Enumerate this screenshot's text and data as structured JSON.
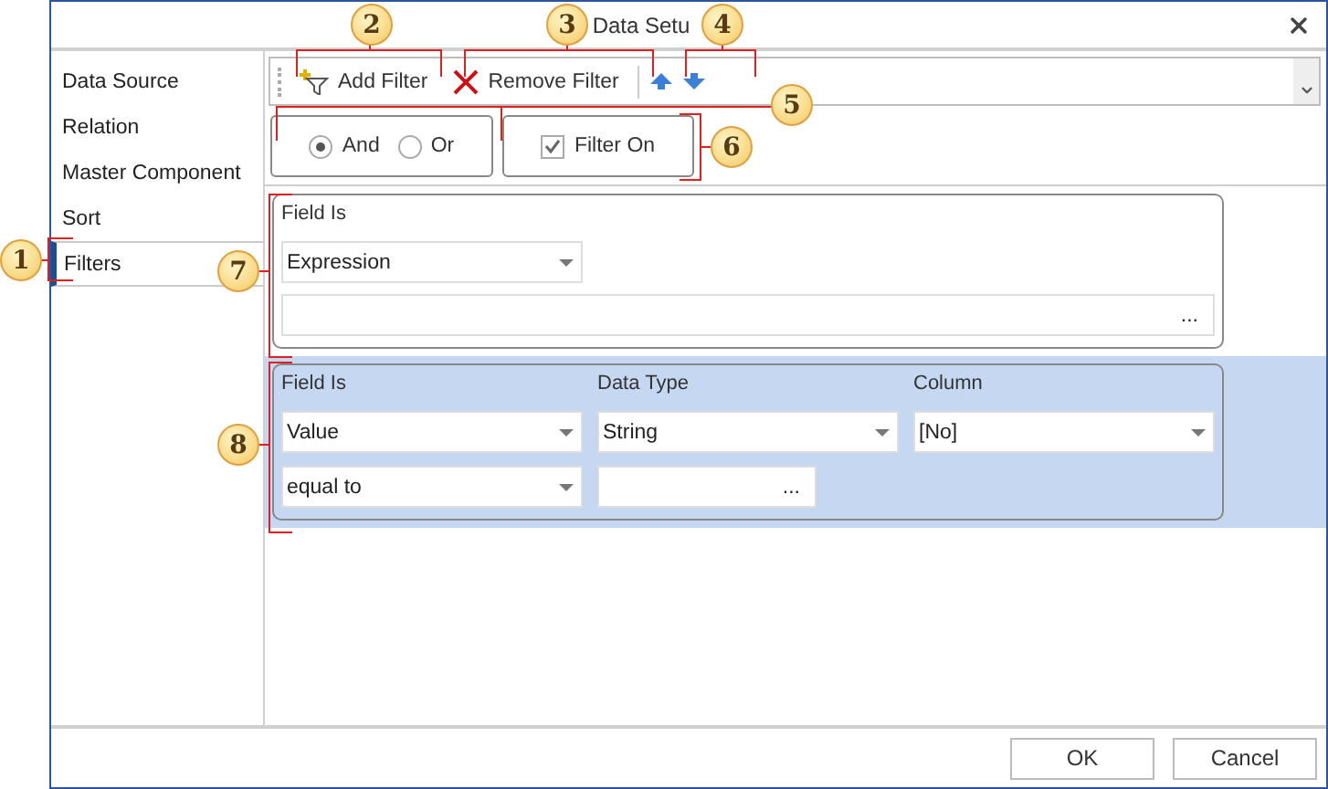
{
  "dialog": {
    "title": "Data Setu"
  },
  "sidebar": {
    "items": [
      {
        "label": "Data Source",
        "selected": false
      },
      {
        "label": "Relation",
        "selected": false
      },
      {
        "label": "Master Component",
        "selected": false
      },
      {
        "label": "Sort",
        "selected": false
      },
      {
        "label": "Filters",
        "selected": true
      }
    ]
  },
  "toolbar": {
    "items": [
      {
        "kind": "add",
        "label": "Add Filter"
      },
      {
        "kind": "remove",
        "label": "Remove Filter"
      },
      {
        "kind": "separator"
      },
      {
        "kind": "up"
      },
      {
        "kind": "down"
      }
    ]
  },
  "logic": [
    {
      "label": "And",
      "selected": true
    },
    {
      "label": "Or",
      "selected": false
    }
  ],
  "filter_on": {
    "label": "Filter On",
    "checked": true
  },
  "filters": [
    {
      "kind": "expression",
      "selected": false,
      "columns": [
        "Field Is"
      ],
      "fields": [
        "Expression"
      ],
      "expression_button": "..."
    },
    {
      "kind": "value",
      "selected": true,
      "columns": [
        "Field Is",
        "Data Type",
        "Column"
      ],
      "fields": [
        "Value",
        "String",
        "[No]"
      ],
      "condition": "equal to",
      "value_button": "..."
    }
  ],
  "buttons": [
    "OK",
    "Cancel"
  ],
  "callouts": [
    "1",
    "2",
    "3",
    "4",
    "5",
    "6",
    "7",
    "8"
  ]
}
